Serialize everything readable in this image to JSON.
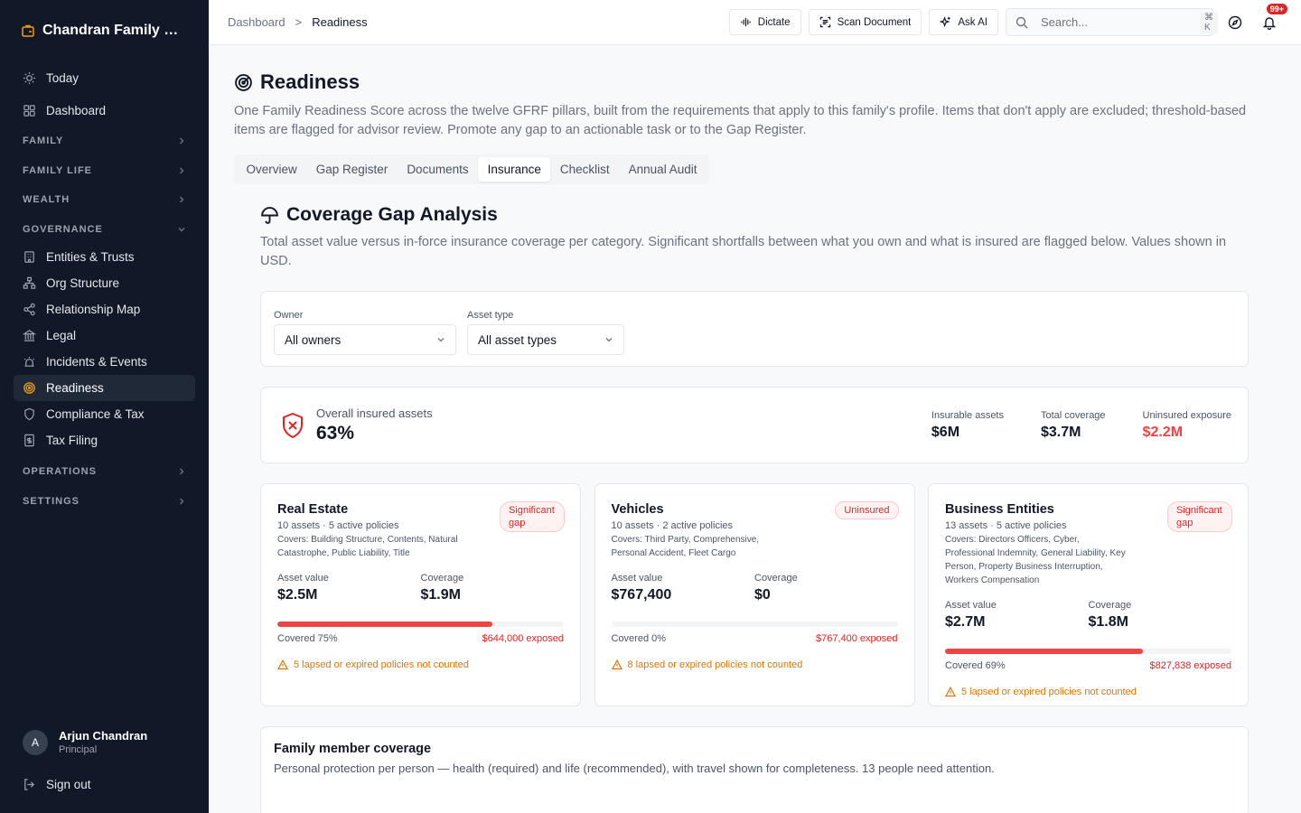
{
  "app": {
    "name": "Chandran Family Office"
  },
  "sidebar": {
    "top": [
      {
        "label": "Today",
        "icon": "sun-icon"
      },
      {
        "label": "Dashboard",
        "icon": "grid-icon"
      }
    ],
    "sections": {
      "family": "FAMILY",
      "family_life": "FAMILY LIFE",
      "wealth": "WEALTH",
      "governance": "GOVERNANCE",
      "operations": "OPERATIONS",
      "settings": "SETTINGS"
    },
    "governance_items": [
      {
        "label": "Entities & Trusts"
      },
      {
        "label": "Org Structure"
      },
      {
        "label": "Relationship Map"
      },
      {
        "label": "Legal"
      },
      {
        "label": "Incidents & Events"
      },
      {
        "label": "Readiness"
      },
      {
        "label": "Compliance & Tax"
      },
      {
        "label": "Tax Filing"
      }
    ],
    "user": {
      "initial": "A",
      "name": "Arjun Chandran",
      "role": "Principal"
    },
    "signout": "Sign out"
  },
  "topbar": {
    "breadcrumb": [
      "Dashboard",
      "Readiness"
    ],
    "buttons": {
      "dictate": "Dictate",
      "scan": "Scan Document",
      "ask": "Ask AI"
    },
    "search_placeholder": "Search...",
    "shortcut": "⌘ K",
    "notifications": "99+"
  },
  "page": {
    "title": "Readiness",
    "description": "One Family Readiness Score across the twelve GFRF pillars, built from the requirements that apply to this family's profile. Items that don't apply are excluded; threshold-based items are flagged for advisor review. Promote any gap to an actionable task or to the Gap Register.",
    "tabs": [
      "Overview",
      "Gap Register",
      "Documents",
      "Insurance",
      "Checklist",
      "Annual Audit"
    ],
    "active_tab": "Insurance"
  },
  "coverage": {
    "title": "Coverage Gap Analysis",
    "description": "Total asset value versus in-force insurance coverage per category. Significant shortfalls between what you own and what is insured are flagged below. Values shown in USD.",
    "filters": {
      "owner_label": "Owner",
      "owner_value": "All owners",
      "type_label": "Asset type",
      "type_value": "All asset types"
    },
    "overall": {
      "label": "Overall insured assets",
      "value": "63%",
      "stats": [
        {
          "label": "Insurable assets",
          "value": "$6M"
        },
        {
          "label": "Total coverage",
          "value": "$3.7M"
        },
        {
          "label": "Uninsured exposure",
          "value": "$2.2M"
        }
      ]
    },
    "categories": [
      {
        "name": "Real Estate",
        "badge": "Significant gap",
        "meta": "10 assets · 5 active policies",
        "covers": "Covers: Building Structure, Contents, Natural Catastrophe, Public Liability, Title",
        "asset_label": "Asset value",
        "asset_value": "$2.5M",
        "cov_label": "Coverage",
        "cov_value": "$1.9M",
        "covered_pct": 75,
        "covered_text": "Covered 75%",
        "exposed": "$644,000 exposed",
        "warning": "5 lapsed or expired policies not counted"
      },
      {
        "name": "Vehicles",
        "badge": "Uninsured",
        "meta": "10 assets · 2 active policies",
        "covers": "Covers: Third Party, Comprehensive, Personal Accident, Fleet Cargo",
        "asset_label": "Asset value",
        "asset_value": "$767,400",
        "cov_label": "Coverage",
        "cov_value": "$0",
        "covered_pct": 0,
        "covered_text": "Covered 0%",
        "exposed": "$767,400 exposed",
        "warning": "8 lapsed or expired policies not counted"
      },
      {
        "name": "Business Entities",
        "badge": "Significant gap",
        "meta": "13 assets · 5 active policies",
        "covers": "Covers: Directors Officers, Cyber, Professional Indemnity, General Liability, Key Person, Property Business Interruption, Workers Compensation",
        "asset_label": "Asset value",
        "asset_value": "$2.7M",
        "cov_label": "Coverage",
        "cov_value": "$1.8M",
        "covered_pct": 69,
        "covered_text": "Covered 69%",
        "exposed": "$827,838 exposed",
        "warning": "5 lapsed or expired policies not counted"
      }
    ]
  },
  "family_coverage": {
    "title": "Family member coverage",
    "description": "Personal protection per person — health (required) and life (recommended), with travel shown for completeness. 13 people need attention."
  }
}
